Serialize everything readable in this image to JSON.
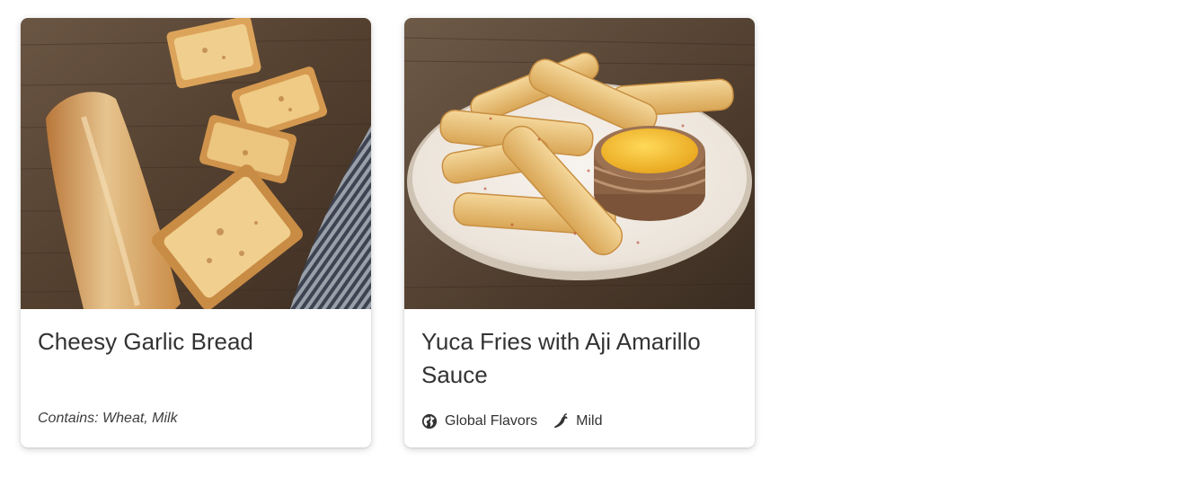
{
  "menu_items": [
    {
      "title": "Cheesy Garlic Bread",
      "image_alt": "Sliced toasted garlic bread with melted cheese on a wooden board next to a striped napkin",
      "allergens": "Contains: Wheat, Milk",
      "tags": []
    },
    {
      "title": "Yuca Fries with Aji Amarillo Sauce",
      "image_alt": "Yuca fries on a white plate with a small bowl of yellow aji amarillo sauce",
      "allergens": "",
      "tags": [
        {
          "label": "Global Flavors",
          "icon": "globe-icon"
        },
        {
          "label": "Mild",
          "icon": "chili-pepper-icon"
        }
      ]
    }
  ],
  "colors": {
    "title_text": "#333333",
    "card_background": "#ffffff",
    "wood_dark": "#4a3a2c",
    "wood_light": "#7a6450",
    "bread_golden": "#d9a55a",
    "sauce_yellow": "#f2b82a"
  }
}
